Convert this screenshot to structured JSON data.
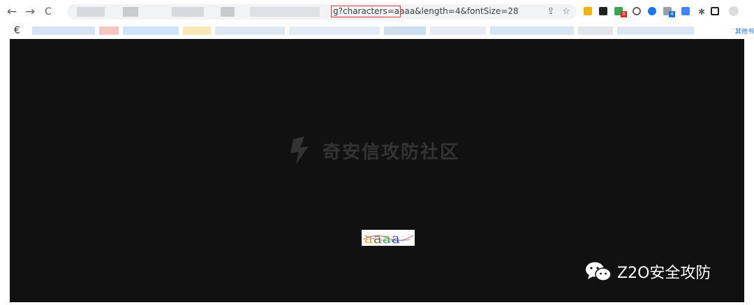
{
  "browser": {
    "nav": {
      "back_icon": "←",
      "forward_icon": "→",
      "reload_icon": "C"
    },
    "address_bar": {
      "url_visible": "g?characters=aaaa&length=4&fontSize=28"
    },
    "toolbar_icons": {
      "share": "⇪",
      "star": "☆"
    },
    "extension_badges": {
      "red": "5",
      "blue": "4"
    },
    "bookmarks": {
      "logo_icon": "€",
      "other_bookmarks": "其他书"
    }
  },
  "page": {
    "watermark_text": "奇安信攻防社区",
    "captcha_text": "aaaa",
    "captcha_colors": [
      "#e2a23b",
      "#8a6d3b",
      "#4caf50",
      "#3f51b5"
    ]
  },
  "footer": {
    "brand": "Z2O安全攻防"
  },
  "colors": {
    "viewport_bg": "#111111",
    "highlight": "#e53935",
    "accent": "#1a73e8"
  }
}
